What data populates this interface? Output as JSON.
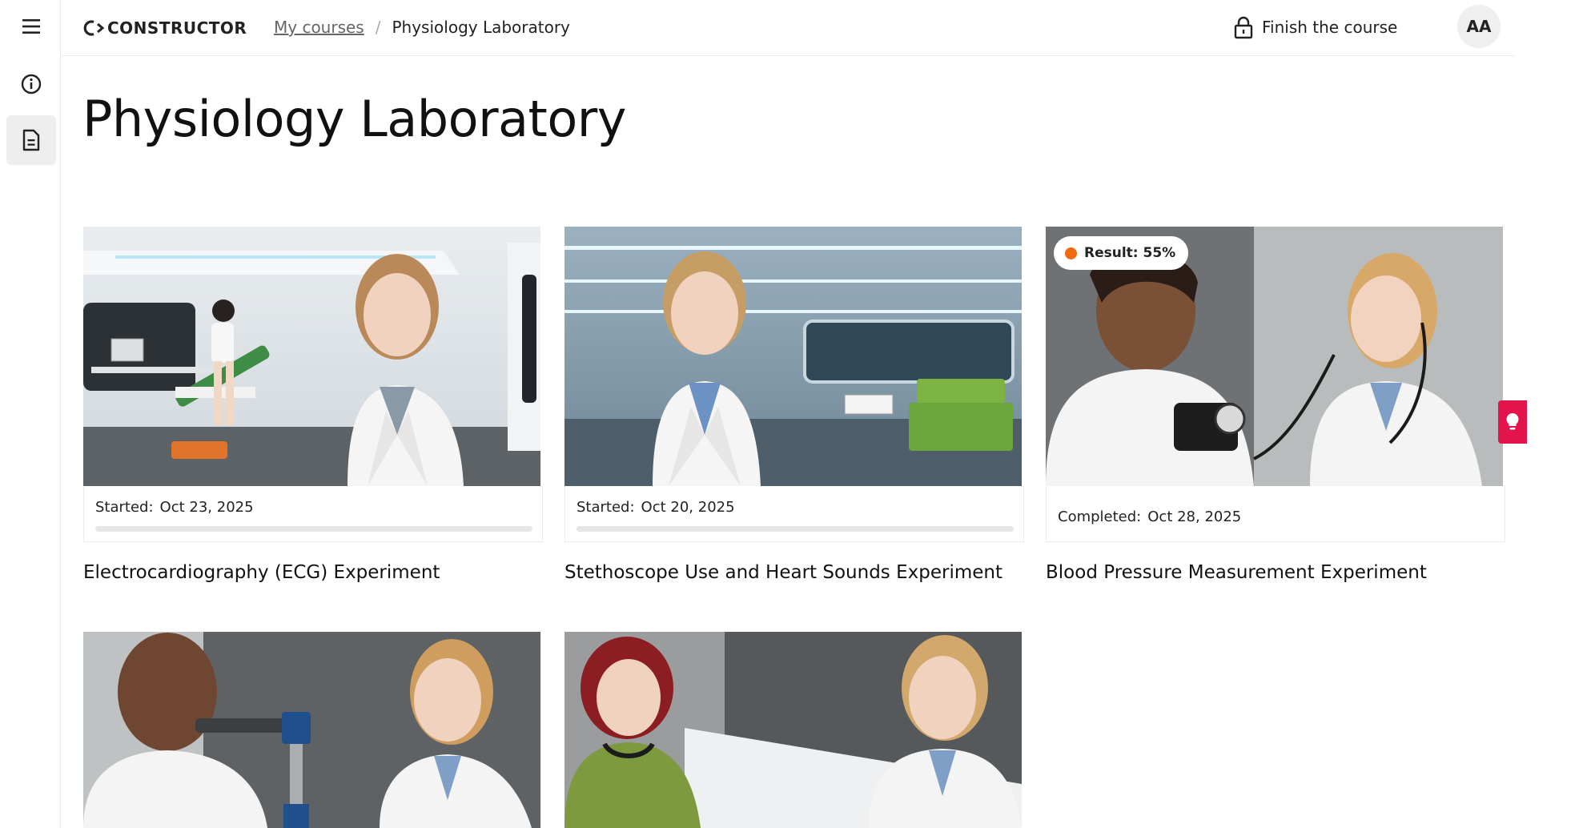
{
  "brand": {
    "name": "CONSTRUCTOR"
  },
  "breadcrumb": {
    "parent": "My courses",
    "separator": "/",
    "current": "Physiology Laboratory"
  },
  "header": {
    "finish_label": "Finish the course",
    "avatar_initials": "AA"
  },
  "page": {
    "title": "Physiology Laboratory"
  },
  "rail": {
    "icons": [
      "menu-icon",
      "info-icon",
      "document-icon"
    ]
  },
  "cards": [
    {
      "title": "Electrocardiography (ECG) Experiment",
      "status_label": "Started:",
      "date": "Oct 23, 2025",
      "progress": 0,
      "image": "lab-room-with-doctor"
    },
    {
      "title": "Stethoscope Use and Heart Sounds Experiment",
      "status_label": "Started:",
      "date": "Oct 20, 2025",
      "progress": 0,
      "image": "lab-room-with-green-bed"
    },
    {
      "title": "Blood Pressure Measurement Experiment",
      "status_label": "Completed:",
      "date": "Oct 28, 2025",
      "result_label": "Result: 55%",
      "result_color": "#f06a10",
      "image": "blood-pressure-check"
    },
    {
      "title": "",
      "image": "spirometry-test"
    },
    {
      "title": "",
      "image": "patient-consultation"
    }
  ],
  "colors": {
    "accent": "#e3134b",
    "result_dot": "#f06a10"
  }
}
